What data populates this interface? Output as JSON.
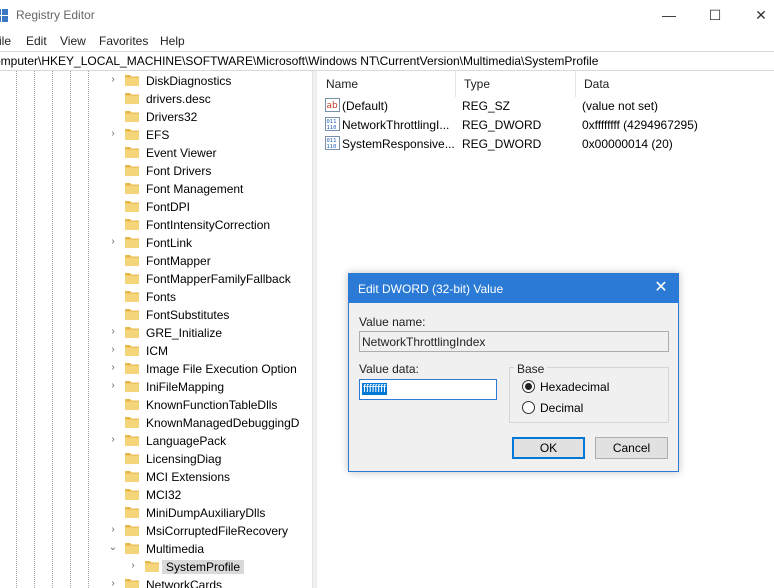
{
  "window": {
    "title": "Registry Editor",
    "min_glyph": "—",
    "max_glyph": "☐",
    "close_glyph": "✕"
  },
  "menu": [
    "ile",
    "Edit",
    "View",
    "Favorites",
    "Help"
  ],
  "address": "omputer\\HKEY_LOCAL_MACHINE\\SOFTWARE\\Microsoft\\Windows NT\\CurrentVersion\\Multimedia\\SystemProfile",
  "tree": {
    "items": [
      {
        "label": "DiskDiagnostics",
        "expandable": true
      },
      {
        "label": "drivers.desc",
        "expandable": false
      },
      {
        "label": "Drivers32",
        "expandable": false
      },
      {
        "label": "EFS",
        "expandable": true
      },
      {
        "label": "Event Viewer",
        "expandable": false
      },
      {
        "label": "Font Drivers",
        "expandable": false
      },
      {
        "label": "Font Management",
        "expandable": false
      },
      {
        "label": "FontDPI",
        "expandable": false
      },
      {
        "label": "FontIntensityCorrection",
        "expandable": false
      },
      {
        "label": "FontLink",
        "expandable": true
      },
      {
        "label": "FontMapper",
        "expandable": false
      },
      {
        "label": "FontMapperFamilyFallback",
        "expandable": false
      },
      {
        "label": "Fonts",
        "expandable": false
      },
      {
        "label": "FontSubstitutes",
        "expandable": false
      },
      {
        "label": "GRE_Initialize",
        "expandable": true
      },
      {
        "label": "ICM",
        "expandable": true
      },
      {
        "label": "Image File Execution Option",
        "expandable": true
      },
      {
        "label": "IniFileMapping",
        "expandable": true
      },
      {
        "label": "KnownFunctionTableDlls",
        "expandable": false
      },
      {
        "label": "KnownManagedDebuggingD",
        "expandable": false
      },
      {
        "label": "LanguagePack",
        "expandable": true
      },
      {
        "label": "LicensingDiag",
        "expandable": false
      },
      {
        "label": "MCI Extensions",
        "expandable": false
      },
      {
        "label": "MCI32",
        "expandable": false
      },
      {
        "label": "MiniDumpAuxiliaryDlls",
        "expandable": false
      },
      {
        "label": "MsiCorruptedFileRecovery",
        "expandable": true
      },
      {
        "label": "Multimedia",
        "expandable": true,
        "expanded": true
      },
      {
        "label": "SystemProfile",
        "expandable": true,
        "child": true,
        "selected": true
      },
      {
        "label": "NetworkCards",
        "expandable": true
      }
    ]
  },
  "list": {
    "columns": [
      "Name",
      "Type",
      "Data"
    ],
    "rows": [
      {
        "icon": "string-value-icon",
        "name": "(Default)",
        "type": "REG_SZ",
        "data": "(value not set)"
      },
      {
        "icon": "binary-value-icon",
        "name": "NetworkThrottlingI...",
        "type": "REG_DWORD",
        "data": "0xffffffff (4294967295)"
      },
      {
        "icon": "binary-value-icon",
        "name": "SystemResponsive...",
        "type": "REG_DWORD",
        "data": "0x00000014 (20)"
      }
    ]
  },
  "dialog": {
    "title": "Edit DWORD (32-bit) Value",
    "close_glyph": "✕",
    "value_name_label": "Value name:",
    "value_name": "NetworkThrottlingIndex",
    "value_data_label": "Value data:",
    "value_data": "ffffffff",
    "base_label": "Base",
    "hex_label": "Hexadecimal",
    "dec_label": "Decimal",
    "base_selected": "Hexadecimal",
    "ok_label": "OK",
    "cancel_label": "Cancel"
  },
  "colors": {
    "accent": "#2b7bd6",
    "folder": "#f4d57a",
    "selection": "#0078d7"
  }
}
